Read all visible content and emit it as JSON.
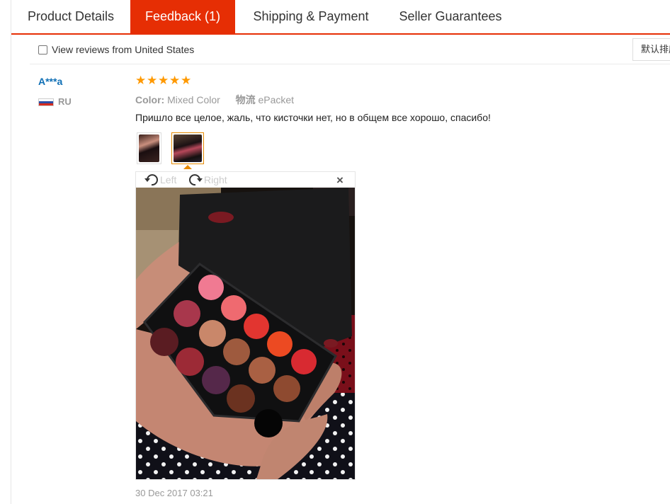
{
  "tabs": [
    {
      "label": "Product Details",
      "active": false
    },
    {
      "label": "Feedback (1)",
      "active": true
    },
    {
      "label": "Shipping & Payment",
      "active": false
    },
    {
      "label": "Seller Guarantees",
      "active": false
    }
  ],
  "filter": {
    "checkbox_label": "View reviews from United States",
    "checked": false,
    "sort_label": "默认排序"
  },
  "review": {
    "buyer_name": "A***a",
    "country": "RU",
    "rating": 5,
    "color_label": "Color:",
    "color_value": "Mixed Color",
    "logistics_label": "物流",
    "logistics_value": "ePacket",
    "text": "Пришло все целое, жаль, что кисточки нет, но в общем все хорошо, спасибо!",
    "date": "30 Dec 2017 03:21"
  },
  "viewer": {
    "rotate_left_label": "Left",
    "rotate_right_label": "Right",
    "close_symbol": "×"
  },
  "colors": {
    "accent": "#e62e04",
    "buyer_link": "#0f6fb5",
    "star": "#ff9900",
    "muted": "#999999",
    "thumb_selected": "#e68a00"
  }
}
